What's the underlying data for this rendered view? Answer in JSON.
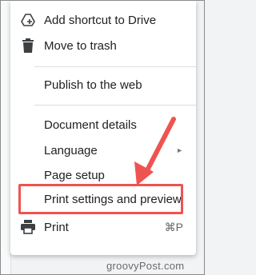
{
  "menu": {
    "items": [
      {
        "label": "Add shortcut to Drive",
        "icon": "add-to-drive-icon"
      },
      {
        "label": "Move to trash",
        "icon": "trash-icon"
      },
      {
        "label": "Publish to the web"
      },
      {
        "label": "Document details"
      },
      {
        "label": "Language",
        "submenu_indicator": "►"
      },
      {
        "label": "Page setup"
      },
      {
        "label": "Print settings and preview"
      },
      {
        "label": "Print",
        "icon": "print-icon",
        "shortcut": "⌘P"
      }
    ]
  },
  "annotation": {
    "highlight_color": "#ef5350",
    "arrow_color": "#ef5350",
    "target": "Print settings and preview"
  },
  "watermark": "groovyPost.com"
}
